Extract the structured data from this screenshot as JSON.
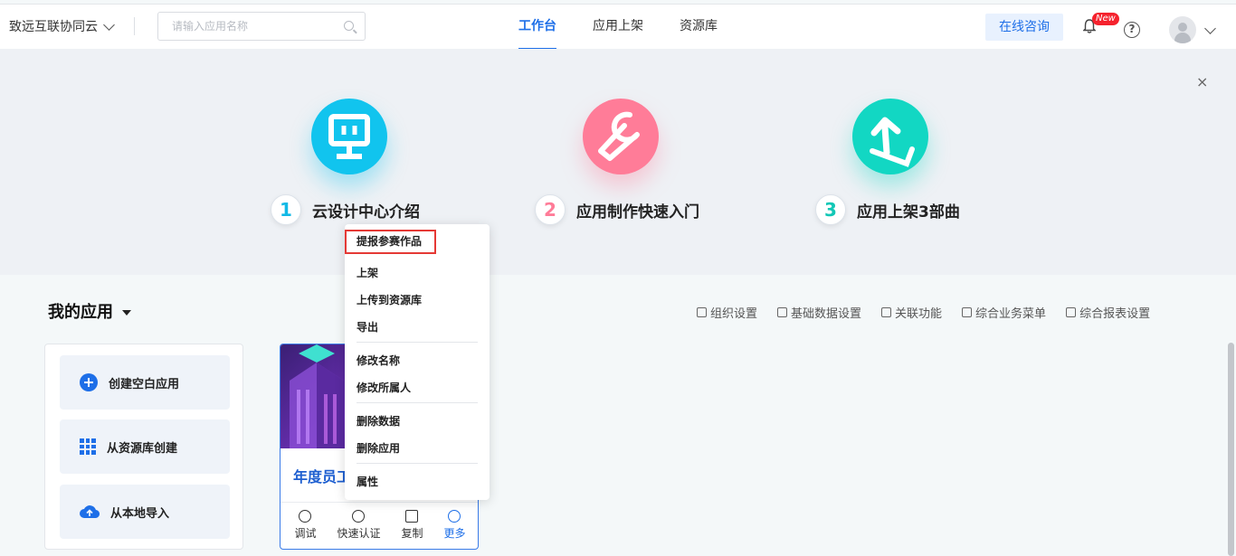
{
  "header": {
    "org_name": "致远互联协同云",
    "search_placeholder": "请输入应用名称",
    "tabs": [
      {
        "label": "工作台",
        "active": true
      },
      {
        "label": "应用上架",
        "active": false
      },
      {
        "label": "资源库",
        "active": false
      }
    ],
    "consult_label": "在线咨询",
    "new_badge": "New",
    "help_glyph": "?"
  },
  "banner": {
    "close_glyph": "×",
    "steps": [
      {
        "num": "1",
        "label": "云设计中心介绍",
        "color": "#11c4ee"
      },
      {
        "num": "2",
        "label": "应用制作快速入门",
        "color": "#ff7c98"
      },
      {
        "num": "3",
        "label": "应用上架3部曲",
        "color": "#12d7c3"
      }
    ]
  },
  "my_apps": {
    "title": "我的应用",
    "settings": [
      "组织设置",
      "基础数据设置",
      "关联功能",
      "综合业务菜单",
      "综合报表设置"
    ],
    "create_buttons": [
      "创建空白应用",
      "从资源库创建",
      "从本地导入"
    ]
  },
  "app_card": {
    "title": "年度员工",
    "actions": [
      "调试",
      "快速认证",
      "复制",
      "更多"
    ]
  },
  "context_menu": {
    "items": [
      "提报参赛作品",
      "上架",
      "上传到资源库",
      "导出",
      "修改名称",
      "修改所属人",
      "删除数据",
      "删除应用",
      "属性"
    ]
  },
  "colors": {
    "accent": "#1e6fe8",
    "highlight_border": "#e53935"
  }
}
